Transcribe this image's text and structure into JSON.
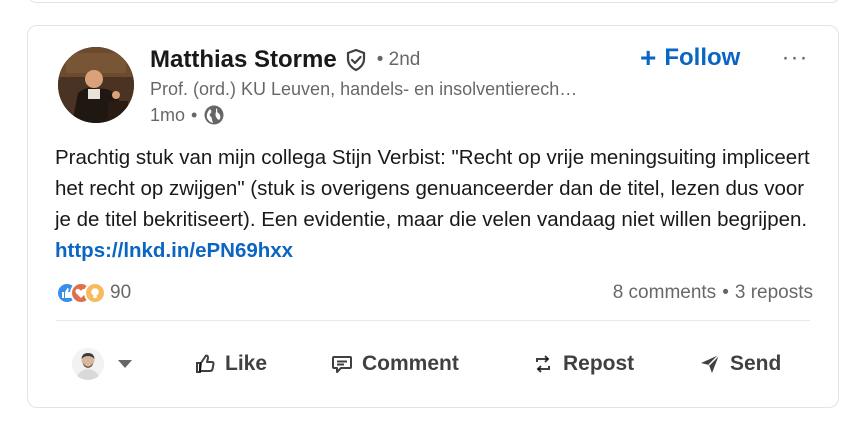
{
  "post": {
    "author_name": "Matthias Storme",
    "degree": "• 2nd",
    "headline": "Prof. (ord.) KU Leuven, handels- en insolventierech…",
    "time": "1mo",
    "meta_dot": "•",
    "follow_label": "Follow",
    "follow_plus": "+",
    "more": "···",
    "text": "Prachtig stuk van mijn collega Stijn Verbist: \"Recht op vrije meningsuiting impliceert het recht op zwijgen\" (stuk is overigens genuanceerder dan de titel, lezen dus voor je de titel bekritiseert). Een evidentie, maar die velen vandaag niet willen begrijpen.",
    "link": "https://lnkd.in/ePN69hxx"
  },
  "social": {
    "reaction_count": "90",
    "reaction_icons": [
      "like-icon",
      "love-icon",
      "insightful-icon"
    ],
    "comments": "8 comments",
    "dot": "•",
    "reposts": "3 reposts"
  },
  "actions": {
    "like": "Like",
    "comment": "Comment",
    "repost": "Repost",
    "send": "Send"
  },
  "colors": {
    "accent": "#0a66c2",
    "secondary_text": "#666666"
  }
}
